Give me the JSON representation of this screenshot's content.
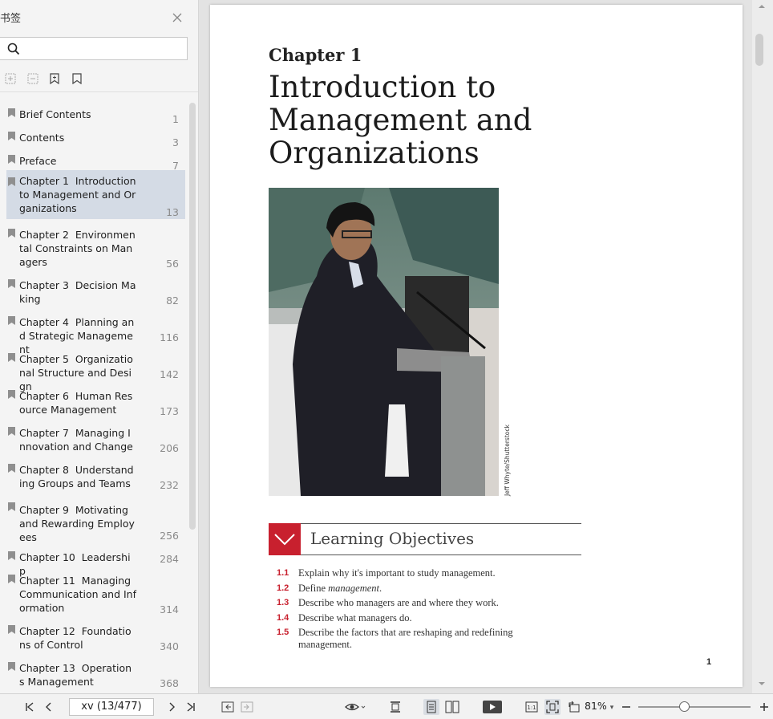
{
  "sidebar": {
    "title": "书签",
    "search": {
      "value": "",
      "placeholder": ""
    },
    "bookmarks": [
      {
        "label": "Brief Contents",
        "page": "1"
      },
      {
        "label": "Contents",
        "page": "3"
      },
      {
        "label": "Preface",
        "page": "7"
      },
      {
        "label": "Chapter 1  Introduction to Management and Organizations",
        "page": "13",
        "selected": true
      },
      {
        "label": "Chapter 2  Environmental Constraints on Managers",
        "page": "56"
      },
      {
        "label": "Chapter 3  Decision Making",
        "page": "82"
      },
      {
        "label": "Chapter 4  Planning and Strategic Management",
        "page": "116"
      },
      {
        "label": "Chapter 5  Organizational Structure and Design",
        "page": "142"
      },
      {
        "label": "Chapter 6  Human Resource Management",
        "page": "173"
      },
      {
        "label": "Chapter 7  Managing Innovation and Change",
        "page": "206"
      },
      {
        "label": "Chapter 8  Understanding Groups and Teams",
        "page": "232"
      },
      {
        "label": "Chapter 9  Motivating and Rewarding Employees",
        "page": "256"
      },
      {
        "label": "Chapter 10  Leadership",
        "page": "284"
      },
      {
        "label": "Chapter 11  Managing Communication and Information",
        "page": "314"
      },
      {
        "label": "Chapter 12  Foundations of Control",
        "page": "340"
      },
      {
        "label": "Chapter 13  Operations Management",
        "page": "368"
      }
    ]
  },
  "page": {
    "kicker": "Chapter 1",
    "title": "Introduction to Management and Organizations",
    "photo_credit": "Jeff Whyte/Shutterstock",
    "learning_objectives": {
      "heading": "Learning Objectives",
      "items": [
        {
          "num": "1.1",
          "text": "Explain why it's important to study management."
        },
        {
          "num": "1.2",
          "text_before": "Define ",
          "text_em": "management",
          "text_after": "."
        },
        {
          "num": "1.3",
          "text": "Describe who managers are and where they work."
        },
        {
          "num": "1.4",
          "text": "Describe what managers do."
        },
        {
          "num": "1.5",
          "text": "Describe the factors that are reshaping and redefining management."
        }
      ]
    },
    "page_number": "1"
  },
  "statusbar": {
    "page_field": "xv (13/477)",
    "zoom": "81%",
    "zoom_level": 0.4
  }
}
